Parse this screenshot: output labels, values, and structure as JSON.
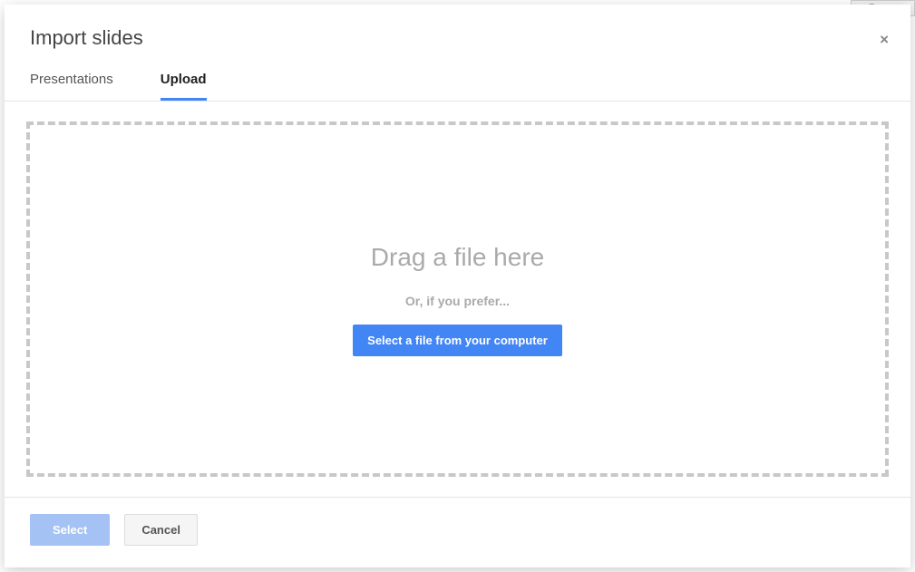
{
  "dialog": {
    "title": "Import slides",
    "tabs": {
      "presentations": "Presentations",
      "upload": "Upload",
      "active": "Upload"
    },
    "dropzone": {
      "drag_title": "Drag a file here",
      "or_text": "Or, if you prefer...",
      "select_file_button": "Select a file from your computer"
    },
    "footer": {
      "select_label": "Select",
      "cancel_label": "Cancel"
    },
    "close_label": "×"
  },
  "background": {
    "present_label": "Present"
  }
}
